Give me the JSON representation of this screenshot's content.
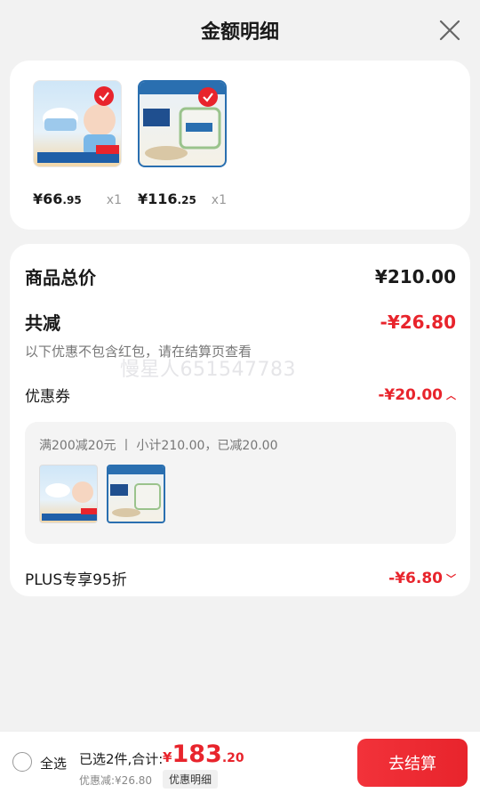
{
  "header": {
    "title": "金额明细"
  },
  "products": [
    {
      "price_int": "¥66",
      "price_dec": ".95",
      "qty": "x1",
      "image": "baby-cream-product"
    },
    {
      "price_int": "¥116",
      "price_dec": ".25",
      "qty": "x1",
      "image": "cetaphil-product"
    }
  ],
  "summary": {
    "total_label": "商品总价",
    "total_value": "¥210.00",
    "discount_label": "共减",
    "discount_value": "-¥26.80",
    "note": "以下优惠不包含红包，请在结算页查看",
    "watermark": "慢星人651547783",
    "coupon_label": "优惠券",
    "coupon_value": "-¥20.00",
    "coupon_detail": "满200减20元 丨 小计210.00，已减20.00",
    "plus_label": "PLUS专享95折",
    "plus_value": "-¥6.80"
  },
  "bottom": {
    "select_all": "全选",
    "selected_info": "已选2件,合计:",
    "total_currency": "¥",
    "total_int": "183",
    "total_dec": ".20",
    "discount_text": "优惠减:¥26.80",
    "detail_tag": "优惠明细",
    "checkout": "去结算"
  },
  "colors": {
    "accent": "#e8242c",
    "bg": "#f2f2f2",
    "card": "#ffffff"
  }
}
